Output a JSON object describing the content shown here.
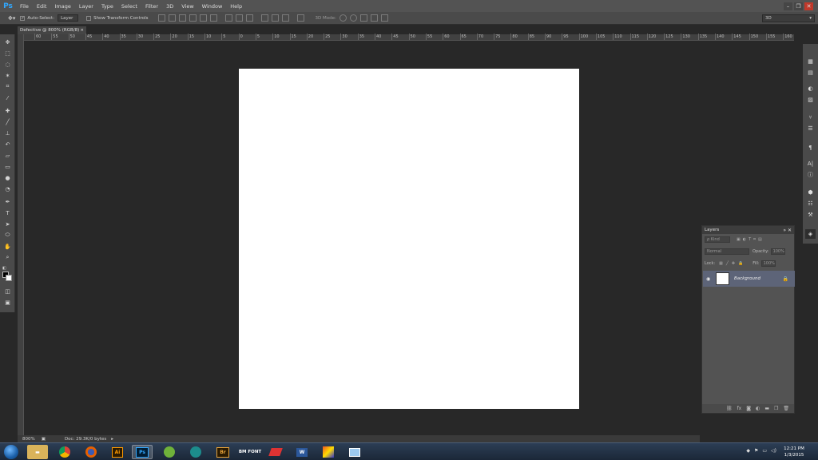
{
  "app": {
    "logo": "Ps",
    "menu": [
      "File",
      "Edit",
      "Image",
      "Layer",
      "Type",
      "Select",
      "Filter",
      "3D",
      "View",
      "Window",
      "Help"
    ],
    "window_controls": [
      "–",
      "❐",
      "✕"
    ]
  },
  "options_bar": {
    "auto_select_label": "Auto-Select:",
    "auto_select_value": "Layer",
    "transform_label": "Show Transform Controls",
    "mode_label": "3D Mode:",
    "workspace": "3D"
  },
  "document": {
    "tab_title": "Defective @ 800% (RGB/8)",
    "tab_close": "×",
    "zoom": "800%",
    "doc_info": "Doc: 29.3K/0 bytes"
  },
  "ruler": {
    "top_labels": [
      "60",
      "55",
      "50",
      "45",
      "40",
      "35",
      "30",
      "25",
      "20",
      "15",
      "10",
      "5",
      "0",
      "5",
      "10",
      "15",
      "20",
      "25",
      "30",
      "35",
      "40",
      "45",
      "50",
      "55",
      "60",
      "65",
      "70",
      "75",
      "80",
      "85",
      "90",
      "95",
      "100",
      "105",
      "110",
      "115",
      "120",
      "125",
      "130",
      "135",
      "140",
      "145",
      "150",
      "155",
      "160"
    ]
  },
  "tools": [
    "move-icon",
    "marquee-icon",
    "lasso-icon",
    "magic-wand-icon",
    "crop-icon",
    "eyedropper-icon",
    "healing-brush-icon",
    "brush-icon",
    "clone-stamp-icon",
    "history-brush-icon",
    "eraser-icon",
    "gradient-icon",
    "blur-icon",
    "dodge-icon",
    "pen-icon",
    "type-icon",
    "path-selection-icon",
    "shape-icon",
    "hand-icon",
    "zoom-icon"
  ],
  "layers_panel": {
    "tab": "Layers",
    "kind_label": "ρ Kind",
    "blend_mode": "Normal",
    "opacity_label": "Opacity:",
    "opacity_value": "100%",
    "lock_label": "Lock:",
    "fill_label": "Fill:",
    "fill_value": "100%",
    "layer_name": "Background"
  },
  "taskbar": {
    "apps": [
      "Explorer",
      "Chrome",
      "Firefox",
      "Ai",
      "Ps",
      "App",
      "App",
      "Br",
      "BM FONT",
      "App",
      "W",
      "App",
      "App"
    ],
    "time": "12:21 PM",
    "date": "1/3/2015"
  },
  "colors": {
    "canvas": "#ffffff",
    "workspace": "#282828",
    "panel": "#535353",
    "accent": "#31a8ff"
  }
}
